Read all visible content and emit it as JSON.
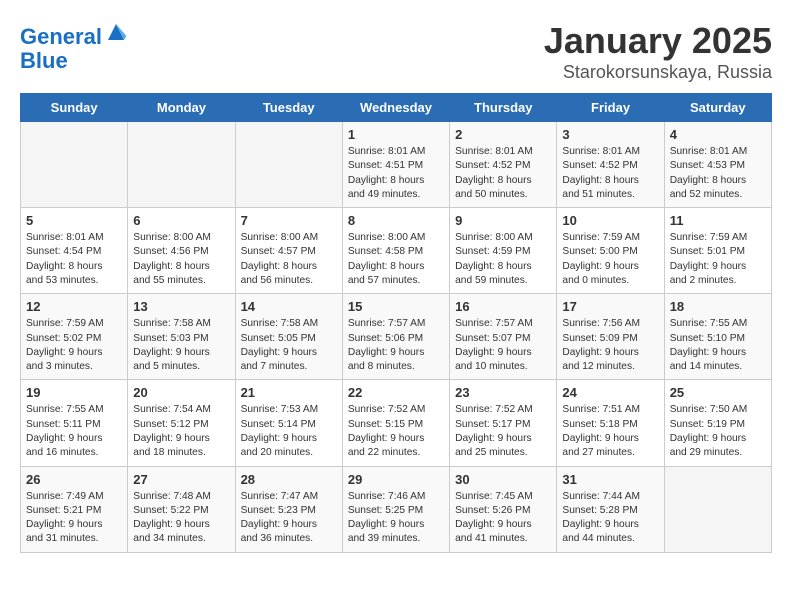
{
  "logo": {
    "line1": "General",
    "line2": "Blue"
  },
  "title": "January 2025",
  "subtitle": "Starokorsunskaya, Russia",
  "days_header": [
    "Sunday",
    "Monday",
    "Tuesday",
    "Wednesday",
    "Thursday",
    "Friday",
    "Saturday"
  ],
  "weeks": [
    [
      {
        "day": "",
        "info": ""
      },
      {
        "day": "",
        "info": ""
      },
      {
        "day": "",
        "info": ""
      },
      {
        "day": "1",
        "info": "Sunrise: 8:01 AM\nSunset: 4:51 PM\nDaylight: 8 hours\nand 49 minutes."
      },
      {
        "day": "2",
        "info": "Sunrise: 8:01 AM\nSunset: 4:52 PM\nDaylight: 8 hours\nand 50 minutes."
      },
      {
        "day": "3",
        "info": "Sunrise: 8:01 AM\nSunset: 4:52 PM\nDaylight: 8 hours\nand 51 minutes."
      },
      {
        "day": "4",
        "info": "Sunrise: 8:01 AM\nSunset: 4:53 PM\nDaylight: 8 hours\nand 52 minutes."
      }
    ],
    [
      {
        "day": "5",
        "info": "Sunrise: 8:01 AM\nSunset: 4:54 PM\nDaylight: 8 hours\nand 53 minutes."
      },
      {
        "day": "6",
        "info": "Sunrise: 8:00 AM\nSunset: 4:56 PM\nDaylight: 8 hours\nand 55 minutes."
      },
      {
        "day": "7",
        "info": "Sunrise: 8:00 AM\nSunset: 4:57 PM\nDaylight: 8 hours\nand 56 minutes."
      },
      {
        "day": "8",
        "info": "Sunrise: 8:00 AM\nSunset: 4:58 PM\nDaylight: 8 hours\nand 57 minutes."
      },
      {
        "day": "9",
        "info": "Sunrise: 8:00 AM\nSunset: 4:59 PM\nDaylight: 8 hours\nand 59 minutes."
      },
      {
        "day": "10",
        "info": "Sunrise: 7:59 AM\nSunset: 5:00 PM\nDaylight: 9 hours\nand 0 minutes."
      },
      {
        "day": "11",
        "info": "Sunrise: 7:59 AM\nSunset: 5:01 PM\nDaylight: 9 hours\nand 2 minutes."
      }
    ],
    [
      {
        "day": "12",
        "info": "Sunrise: 7:59 AM\nSunset: 5:02 PM\nDaylight: 9 hours\nand 3 minutes."
      },
      {
        "day": "13",
        "info": "Sunrise: 7:58 AM\nSunset: 5:03 PM\nDaylight: 9 hours\nand 5 minutes."
      },
      {
        "day": "14",
        "info": "Sunrise: 7:58 AM\nSunset: 5:05 PM\nDaylight: 9 hours\nand 7 minutes."
      },
      {
        "day": "15",
        "info": "Sunrise: 7:57 AM\nSunset: 5:06 PM\nDaylight: 9 hours\nand 8 minutes."
      },
      {
        "day": "16",
        "info": "Sunrise: 7:57 AM\nSunset: 5:07 PM\nDaylight: 9 hours\nand 10 minutes."
      },
      {
        "day": "17",
        "info": "Sunrise: 7:56 AM\nSunset: 5:09 PM\nDaylight: 9 hours\nand 12 minutes."
      },
      {
        "day": "18",
        "info": "Sunrise: 7:55 AM\nSunset: 5:10 PM\nDaylight: 9 hours\nand 14 minutes."
      }
    ],
    [
      {
        "day": "19",
        "info": "Sunrise: 7:55 AM\nSunset: 5:11 PM\nDaylight: 9 hours\nand 16 minutes."
      },
      {
        "day": "20",
        "info": "Sunrise: 7:54 AM\nSunset: 5:12 PM\nDaylight: 9 hours\nand 18 minutes."
      },
      {
        "day": "21",
        "info": "Sunrise: 7:53 AM\nSunset: 5:14 PM\nDaylight: 9 hours\nand 20 minutes."
      },
      {
        "day": "22",
        "info": "Sunrise: 7:52 AM\nSunset: 5:15 PM\nDaylight: 9 hours\nand 22 minutes."
      },
      {
        "day": "23",
        "info": "Sunrise: 7:52 AM\nSunset: 5:17 PM\nDaylight: 9 hours\nand 25 minutes."
      },
      {
        "day": "24",
        "info": "Sunrise: 7:51 AM\nSunset: 5:18 PM\nDaylight: 9 hours\nand 27 minutes."
      },
      {
        "day": "25",
        "info": "Sunrise: 7:50 AM\nSunset: 5:19 PM\nDaylight: 9 hours\nand 29 minutes."
      }
    ],
    [
      {
        "day": "26",
        "info": "Sunrise: 7:49 AM\nSunset: 5:21 PM\nDaylight: 9 hours\nand 31 minutes."
      },
      {
        "day": "27",
        "info": "Sunrise: 7:48 AM\nSunset: 5:22 PM\nDaylight: 9 hours\nand 34 minutes."
      },
      {
        "day": "28",
        "info": "Sunrise: 7:47 AM\nSunset: 5:23 PM\nDaylight: 9 hours\nand 36 minutes."
      },
      {
        "day": "29",
        "info": "Sunrise: 7:46 AM\nSunset: 5:25 PM\nDaylight: 9 hours\nand 39 minutes."
      },
      {
        "day": "30",
        "info": "Sunrise: 7:45 AM\nSunset: 5:26 PM\nDaylight: 9 hours\nand 41 minutes."
      },
      {
        "day": "31",
        "info": "Sunrise: 7:44 AM\nSunset: 5:28 PM\nDaylight: 9 hours\nand 44 minutes."
      },
      {
        "day": "",
        "info": ""
      }
    ]
  ]
}
